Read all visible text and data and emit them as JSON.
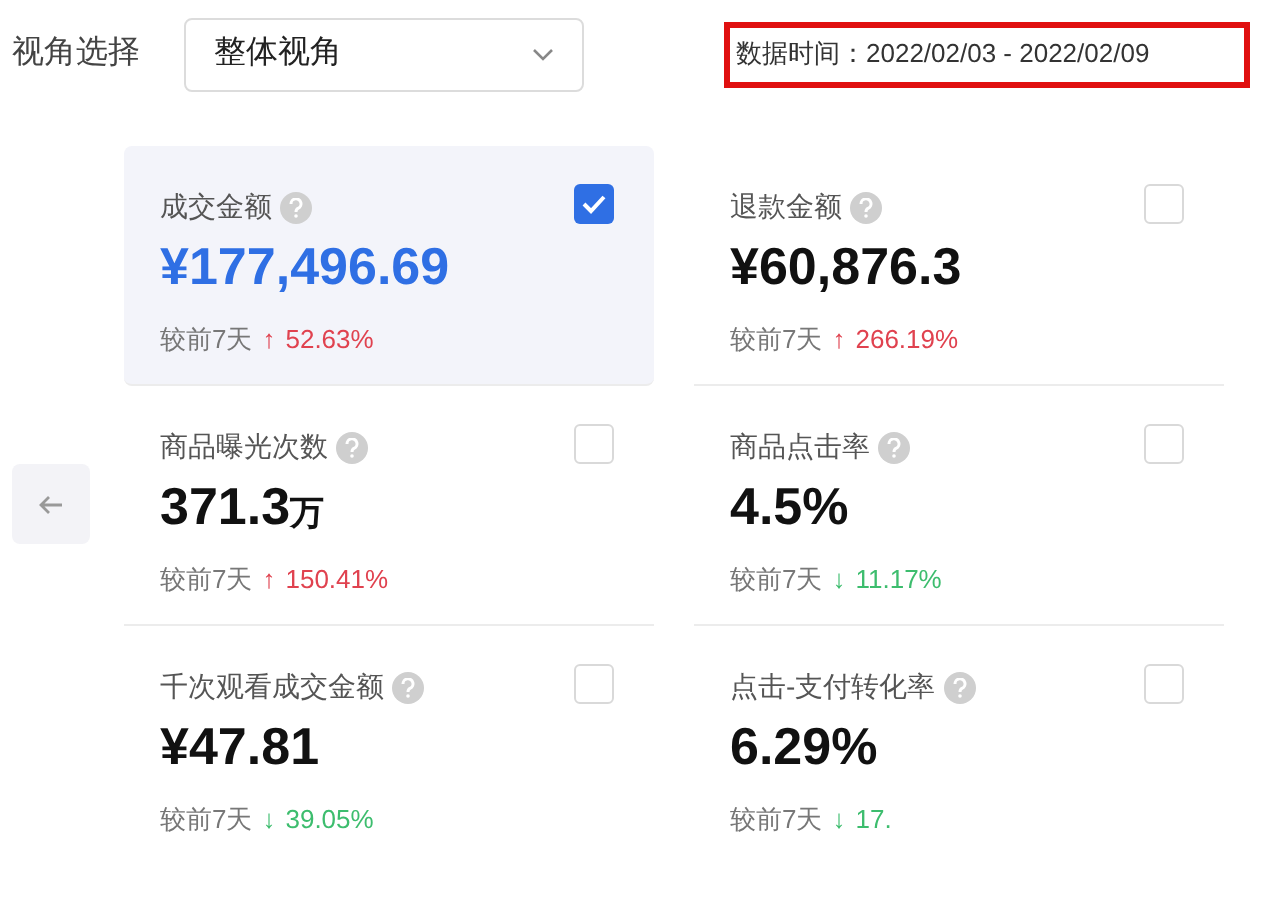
{
  "filter": {
    "label": "视角选择",
    "value": "整体视角"
  },
  "date_range": "数据时间：2022/02/03 - 2022/02/09",
  "cards": [
    {
      "label": "成交金额",
      "value": "¥177,496.69",
      "checked": true,
      "compare": "较前7天",
      "kind": "rise",
      "arrow": "↑",
      "change": "52.63%"
    },
    {
      "label": "退款金额",
      "value": "¥60,876.3",
      "checked": false,
      "compare": "较前7天",
      "kind": "rise",
      "arrow": "↑",
      "change": "266.19%"
    },
    {
      "label": "商品曝光次数",
      "value": "371.3",
      "unit": "万",
      "checked": false,
      "compare": "较前7天",
      "kind": "rise",
      "arrow": "↑",
      "change": "150.41%"
    },
    {
      "label": "商品点击率",
      "value": "4.5%",
      "checked": false,
      "compare": "较前7天",
      "kind": "fall",
      "arrow": "↓",
      "change": "11.17%"
    },
    {
      "label": "千次观看成交金额",
      "value": "¥47.81",
      "checked": false,
      "compare": "较前7天",
      "kind": "fall",
      "arrow": "↓",
      "change": "39.05%"
    },
    {
      "label": "点击-支付转化率",
      "value": "6.29%",
      "checked": false,
      "compare": "较前7天",
      "kind": "fall",
      "arrow": "↓",
      "change": "17."
    }
  ]
}
